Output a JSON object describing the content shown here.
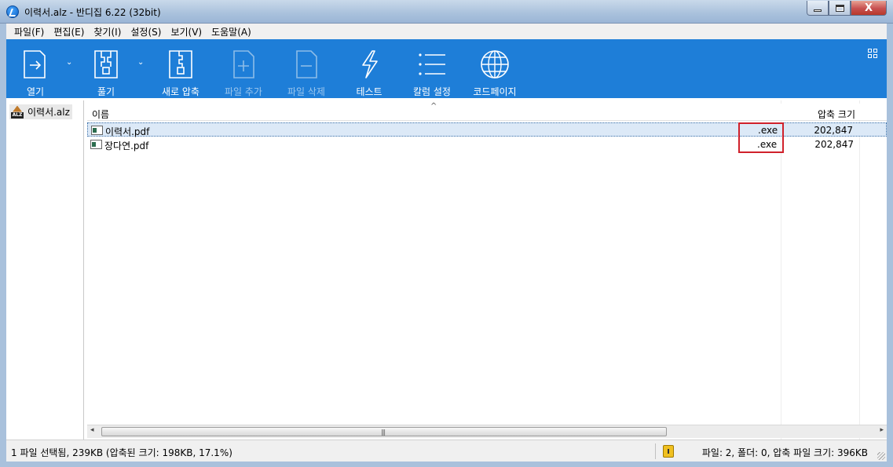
{
  "window": {
    "title": "이력서.alz - 반디집 6.22 (32bit)",
    "close_glyph": "X"
  },
  "menu": [
    {
      "label": "파일(F)"
    },
    {
      "label": "편집(E)"
    },
    {
      "label": "찾기(I)"
    },
    {
      "label": "설정(S)"
    },
    {
      "label": "보기(V)"
    },
    {
      "label": "도움말(A)"
    }
  ],
  "toolbar": {
    "open_label": "열기",
    "extract_label": "풀기",
    "new_label": "새로 압축",
    "add_label": "파일 추가",
    "delete_label": "파일 삭제",
    "test_label": "테스트",
    "columns_label": "칼럼 설정",
    "homepage_label": "코드페이지",
    "dropdown_glyph": "⌄"
  },
  "tree": {
    "archive_name": "이력서.alz",
    "icon_tag": "ALZ"
  },
  "list": {
    "col_name": "이름",
    "col_size": "압축 크기",
    "sort_caret": "^",
    "rows": [
      {
        "name": "이력서.pdf",
        "ext": ".exe",
        "size": "202,847",
        "selected": true
      },
      {
        "name": "장다연.pdf",
        "ext": ".exe",
        "size": "202,847",
        "selected": false
      }
    ]
  },
  "scrollbar": {
    "left_arrow": "◂",
    "right_arrow": "▸",
    "grip": "|||"
  },
  "status": {
    "left": "1 파일 선택됨, 239KB (압축된 크기: 198KB, 17.1%)",
    "right": "파일: 2, 폴더: 0, 압축 파일 크기: 396KB"
  },
  "colors": {
    "toolbar_bg": "#1e7ed8",
    "highlight_box": "#d0212b",
    "selection": "#dce9f7"
  }
}
